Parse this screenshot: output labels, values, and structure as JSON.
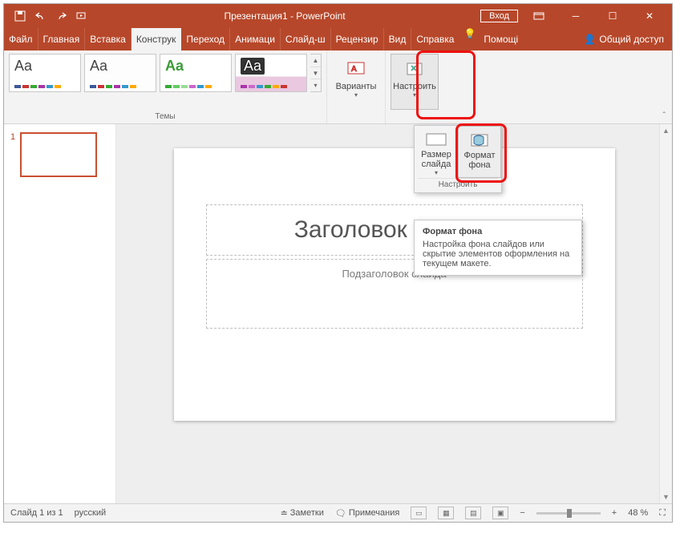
{
  "titlebar": {
    "title": "Презентация1 - PowerPoint",
    "signin": "Вход"
  },
  "tabs": {
    "file": "Файл",
    "home": "Главная",
    "insert": "Вставка",
    "design": "Конструк",
    "transitions": "Переход",
    "animations": "Анимаци",
    "slideshow": "Слайд-ш",
    "review": "Рецензир",
    "view": "Вид",
    "help": "Справка",
    "tellme": "Помощі",
    "share": "Общий доступ"
  },
  "ribbon": {
    "themes_label": "Темы",
    "variants": "Варианты",
    "customize": "Настроить"
  },
  "dropdown": {
    "slide_size": "Размер слайда",
    "format_bg": "Формат фона",
    "group_label": "Настроить"
  },
  "tooltip": {
    "title": "Формат фона",
    "body": "Настройка фона слайдов или скрытие элементов оформления на текущем макете."
  },
  "thumbs": {
    "n1": "1"
  },
  "slide": {
    "title": "Заголовок слайда",
    "subtitle": "Подзаголовок слайда"
  },
  "status": {
    "slide_of": "Слайд 1 из 1",
    "lang": "русский",
    "notes": "Заметки",
    "comments": "Примечания",
    "zoom_minus": "−",
    "zoom_plus": "+",
    "zoom_pct": "48 %"
  }
}
